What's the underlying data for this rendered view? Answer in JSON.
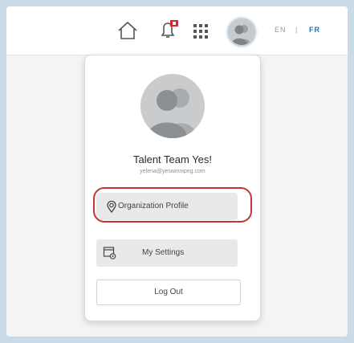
{
  "header": {
    "icons": [
      "home-icon",
      "notification-bell-icon",
      "apps-grid-icon",
      "user-avatar"
    ],
    "notification_color": "#d7262c",
    "languages": {
      "en": "EN",
      "separator": "|",
      "fr": "FR"
    }
  },
  "dropdown": {
    "user_name": "Talent Team Yes!",
    "user_email": "yelena@yeswinnipeg.com",
    "menu": {
      "organization_profile": "Organization Profile",
      "my_settings": "My Settings",
      "log_out": "Log Out"
    },
    "highlight_color": "#c8323a"
  }
}
